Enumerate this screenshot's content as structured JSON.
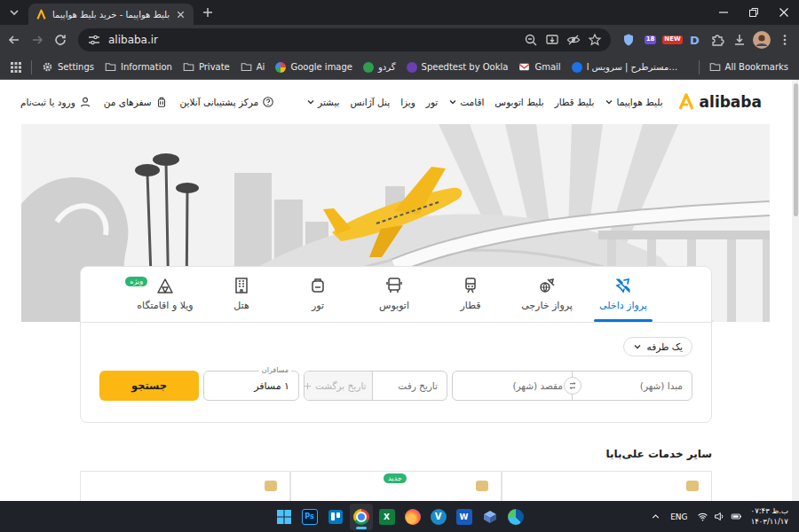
{
  "browser": {
    "tab": {
      "title": "بلیط هواپیما - خرید بلیط هواپیما",
      "selected": true
    },
    "url": "alibaba.ir",
    "extensions": [
      {
        "kind": "shield"
      },
      {
        "kind": "badge",
        "label": "18",
        "color": "#6c4ee3"
      },
      {
        "kind": "badge",
        "label": "NEW",
        "color": "#d93025"
      },
      {
        "kind": "letter",
        "label": "D"
      },
      {
        "kind": "puzzle"
      },
      {
        "kind": "download"
      }
    ]
  },
  "bookmarks": {
    "items": [
      {
        "label": "Settings",
        "kind": "settings"
      },
      {
        "label": "Information",
        "kind": "folder"
      },
      {
        "label": "Private",
        "kind": "folder"
      },
      {
        "label": "Ai",
        "kind": "folder"
      },
      {
        "label": "Google image",
        "kind": "google"
      },
      {
        "label": "گردو",
        "kind": "site",
        "color": "#2e9e4f"
      },
      {
        "label": "Speedtest by Ookla",
        "kind": "site",
        "color": "#6a3fb5"
      },
      {
        "label": "Gmail",
        "kind": "gmail"
      },
      {
        "label": "مسترطرح | سرویس ا…",
        "kind": "site",
        "color": "#1a73e8"
      }
    ],
    "all_bookmarks": "All Bookmarks"
  },
  "site": {
    "logo": "alibaba",
    "nav": [
      {
        "label": "بلیط هواپیما",
        "has_menu": true
      },
      {
        "label": "بلیط قطار",
        "has_menu": false
      },
      {
        "label": "بلیط اتوبوس",
        "has_menu": false
      },
      {
        "label": "اقامت",
        "has_menu": true
      },
      {
        "label": "تور",
        "has_menu": false
      },
      {
        "label": "ویزا",
        "has_menu": false
      },
      {
        "label": "پنل آژانس",
        "has_menu": false
      },
      {
        "label": "بیشتر",
        "has_menu": true
      }
    ],
    "account_links": [
      {
        "label": "مرکز پشتیبانی آنلاین",
        "kind": "support"
      },
      {
        "label": "سفرهای من",
        "kind": "trips"
      },
      {
        "label": "ورود یا ثبت‌نام",
        "kind": "login"
      }
    ]
  },
  "search_card": {
    "tabs": [
      {
        "label": "پرواز داخلی",
        "kind": "domestic",
        "selected": true,
        "badge": null
      },
      {
        "label": "پرواز خارجی",
        "kind": "international",
        "selected": false,
        "badge": null
      },
      {
        "label": "قطار",
        "kind": "train",
        "selected": false,
        "badge": null
      },
      {
        "label": "اتوبوس",
        "kind": "bus",
        "selected": false,
        "badge": null
      },
      {
        "label": "تور",
        "kind": "tour",
        "selected": false,
        "badge": null
      },
      {
        "label": "هتل",
        "kind": "hotel",
        "selected": false,
        "badge": null
      },
      {
        "label": "ویلا و اقامتگاه",
        "kind": "villa",
        "selected": false,
        "badge": "ویژه"
      }
    ],
    "trip_type": "یک طرفه",
    "origin": "مبدا (شهر)",
    "destination": "مقصد (شهر)",
    "depart_date": "تاریخ رفت",
    "return_date": {
      "placeholder": "تاریخ برگشت",
      "disabled": true
    },
    "passengers": {
      "label": "مسافران",
      "value": "۱ مسافر"
    },
    "search_button": "جستجو"
  },
  "other_services": {
    "title": "سایر خدمات علی‌بابا",
    "cards": [
      {
        "badge": null
      },
      {
        "badge": "جدید"
      },
      {
        "badge": null
      }
    ]
  },
  "taskbar": {
    "apps": [
      {
        "kind": "windows",
        "selected": false
      },
      {
        "kind": "photoshop",
        "label": "Ps",
        "selected": false
      },
      {
        "kind": "trello",
        "selected": false
      },
      {
        "kind": "chrome",
        "selected": true
      },
      {
        "kind": "excel",
        "label": "X",
        "selected": false
      },
      {
        "kind": "firefox",
        "selected": false
      },
      {
        "kind": "v",
        "label": "V",
        "selected": false
      },
      {
        "kind": "word",
        "label": "W",
        "selected": false
      },
      {
        "kind": "app",
        "selected": false
      },
      {
        "kind": "edge",
        "selected": false
      }
    ],
    "language": "ENG",
    "time": "۰۷:۴۳ ب.ظ",
    "date": "۱۴۰۳/۱۱/۱۷"
  }
}
